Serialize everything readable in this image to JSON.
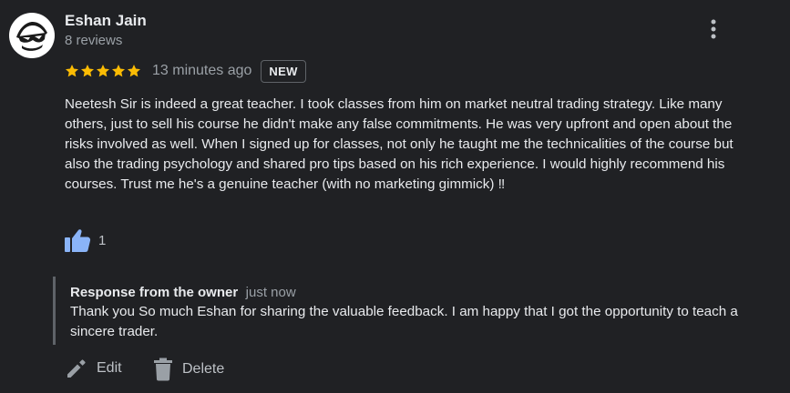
{
  "review": {
    "author": {
      "name": "Eshan Jain",
      "reviews": "8 reviews"
    },
    "rating": 5,
    "time": "13 minutes ago",
    "badge": "NEW",
    "text": "Neetesh Sir is indeed a great teacher. I took classes from him on market neutral trading strategy. Like many others, just to sell his course he didn't make any false commitments. He was very upfront and open about the risks involved as well. When I signed up for classes, not only he taught me the technicalities of the course but also the trading psychology and shared pro tips based on his rich experience. I would highly recommend his courses. Trust me he's a genuine teacher (with no marketing gimmick) ‼",
    "likes": "1"
  },
  "owner_response": {
    "title": "Response from the owner",
    "time": "just now",
    "text": "Thank you So much Eshan for sharing the valuable feedback. I am happy that I got the opportunity to teach a sincere trader."
  },
  "actions": {
    "edit_label": "Edit",
    "delete_label": "Delete"
  },
  "colors": {
    "background": "#202124",
    "star": "#fbbc04",
    "like": "#8ab4f8",
    "text_primary": "#e8eaed",
    "text_secondary": "#9aa0a6"
  },
  "icons": {
    "more": "more-vert-icon",
    "like": "thumb-up-icon",
    "edit": "pencil-icon",
    "delete": "trash-icon",
    "star": "star-icon"
  }
}
